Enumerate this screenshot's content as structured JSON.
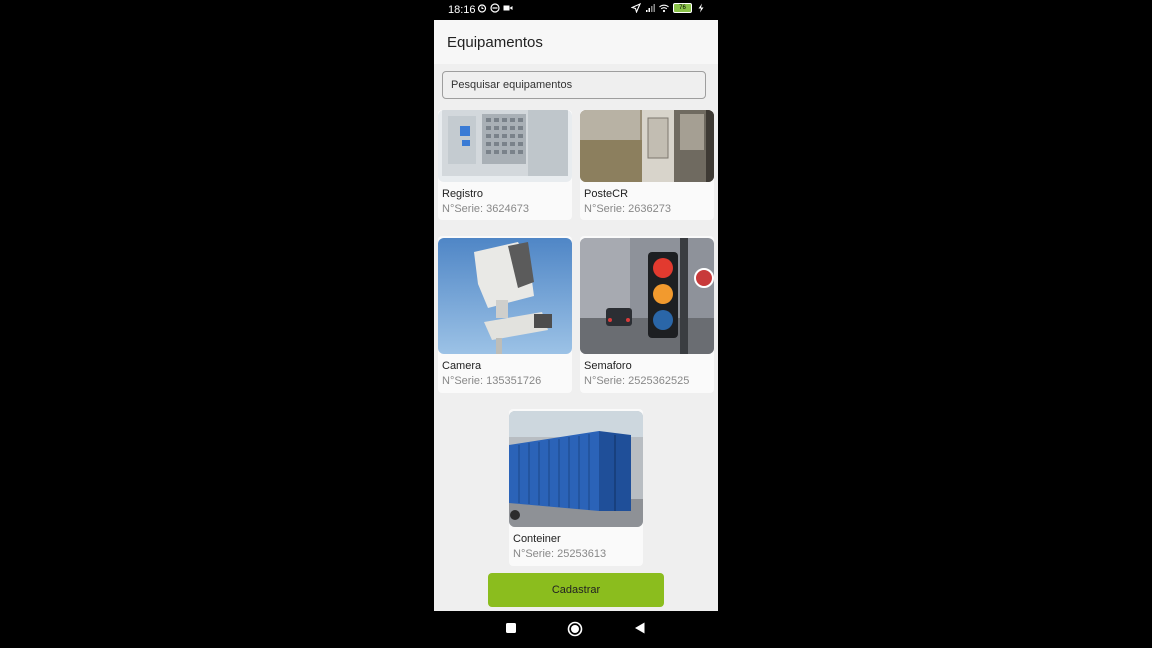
{
  "status": {
    "time": "18:16",
    "battery": "76"
  },
  "appbar": {
    "title": "Equipamentos"
  },
  "search": {
    "placeholder": "Pesquisar equipamentos"
  },
  "equipments": [
    {
      "name": "Registro",
      "serial": "N°Serie: 3624673"
    },
    {
      "name": "PosteCR",
      "serial": "N°Serie: 2636273"
    },
    {
      "name": "Camera",
      "serial": "N°Serie: 135351726"
    },
    {
      "name": "Semaforo",
      "serial": "N°Serie: 2525362525"
    },
    {
      "name": "Conteiner",
      "serial": "N°Serie: 25253613"
    }
  ],
  "actions": {
    "register_label": "Cadastrar"
  },
  "colors": {
    "accent": "#8bbd1e",
    "background": "#efefef",
    "appbar": "#f7f7f7"
  },
  "icons": [
    "alarm-icon",
    "dnd-icon",
    "video-icon",
    "location-icon",
    "signal-icon",
    "wifi-icon",
    "battery-icon",
    "charging-icon",
    "recents-icon",
    "home-icon",
    "back-icon"
  ]
}
